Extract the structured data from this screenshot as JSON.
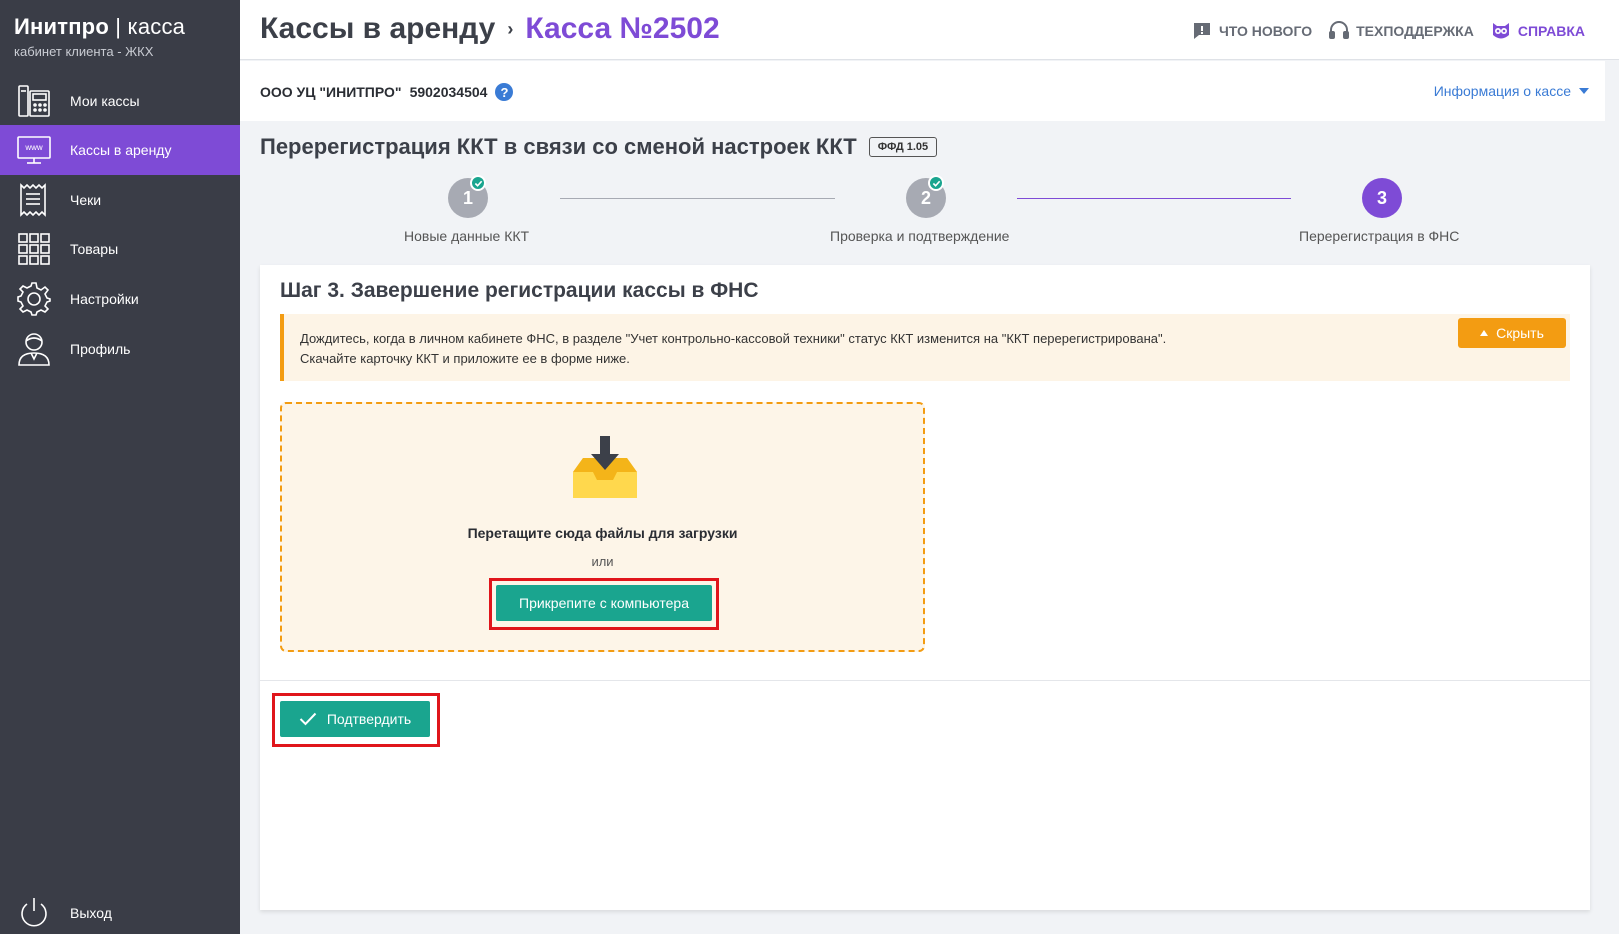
{
  "sidebar": {
    "brand_main": "Инитпро",
    "brand_sep": " | ",
    "brand_light": "касса",
    "brand_sub": "кабинет клиента - ЖКХ",
    "items": [
      {
        "label": "Мои кассы",
        "icon": "cash-register-icon"
      },
      {
        "label": "Кассы в аренду",
        "icon": "www-monitor-icon"
      },
      {
        "label": "Чеки",
        "icon": "receipt-icon"
      },
      {
        "label": "Товары",
        "icon": "grid-icon"
      },
      {
        "label": "Настройки",
        "icon": "gear-icon"
      },
      {
        "label": "Профиль",
        "icon": "user-icon"
      }
    ],
    "logout_label": "Выход"
  },
  "header": {
    "crumb_parent": "Кассы в аренду",
    "crumb_sep": "›",
    "crumb_current": "Касса №2502",
    "links": {
      "whats_new": "ЧТО НОВОГО",
      "support": "ТЕХПОДДЕРЖКА",
      "help": "СПРАВКА"
    }
  },
  "org": {
    "name": "ООО УЦ \"ИНИТПРО\"",
    "inn": "5902034504",
    "help_glyph": "?",
    "info_link": "Информация о кассе"
  },
  "page": {
    "heading": "Перерегистрация ККТ в связи со сменой настроек ККТ",
    "tag": "ФФД 1.05"
  },
  "stepper": {
    "steps": [
      {
        "num": "1",
        "label": "Новые данные ККТ",
        "state": "done"
      },
      {
        "num": "2",
        "label": "Проверка и подтверждение",
        "state": "done"
      },
      {
        "num": "3",
        "label": "Перерегистрация в ФНС",
        "state": "current"
      }
    ]
  },
  "card": {
    "title": "Шаг 3. Завершение регистрации кассы в ФНС",
    "alert_line1": "Дождитесь, когда в личном кабинете ФНС, в разделе \"Учет контрольно-кассовой техники\" статус ККТ изменится на \"ККТ перерегистрирована\".",
    "alert_line2": "Скачайте карточку ККТ и приложите ее в форме ниже.",
    "hide_label": "Скрыть",
    "dropzone_text": "Перетащите сюда файлы для загрузки",
    "dropzone_or": "или",
    "attach_label": "Прикрепите с компьютера",
    "confirm_label": "Подтвердить"
  },
  "colors": {
    "sidebar_bg": "#3a3d47",
    "accent_purple": "#7e4bd6",
    "teal": "#1aa58f",
    "orange": "#f39c12",
    "highlight_red": "#e0151b"
  }
}
